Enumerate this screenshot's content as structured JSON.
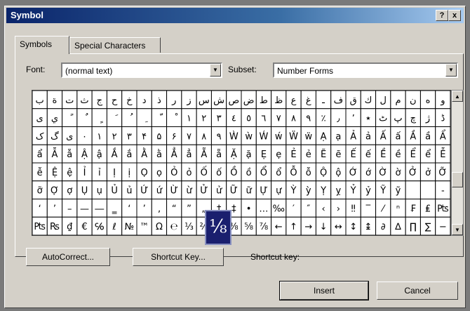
{
  "window": {
    "title": "Symbol",
    "help_label": "?",
    "close_label": "x"
  },
  "tabs": [
    {
      "label": "Symbols"
    },
    {
      "label": "Special Characters"
    }
  ],
  "font": {
    "label": "Font:",
    "value": "(normal text)"
  },
  "subset": {
    "label": "Subset:",
    "value": "Number Forms"
  },
  "popup": {
    "value": "⅛"
  },
  "buttons": {
    "autocorrect": "AutoCorrect...",
    "shortcut_key": "Shortcut Key...",
    "shortcut_label": "Shortcut key:",
    "insert": "Insert",
    "cancel": "Cancel"
  },
  "grid": {
    "rows": [
      [
        "ب",
        "ة",
        "ت",
        "ث",
        "ج",
        "ح",
        "خ",
        "د",
        "ذ",
        "ر",
        "ز",
        "س",
        "ش",
        "ص",
        "ض",
        "ط",
        "ظ",
        "ع",
        "غ",
        "ـ",
        "ف",
        "ق",
        "ك",
        "ل",
        "م",
        "ن",
        "ه",
        "و"
      ],
      [
        "ى",
        "ي",
        "ً",
        "ٌ",
        "ٍ",
        "َ",
        "ُ",
        "ِ",
        "ّ",
        "ْ",
        "١",
        "٢",
        "٣",
        "٤",
        "٥",
        "٦",
        "٧",
        "٨",
        "٩",
        "٪",
        "٫",
        "٬",
        "٭",
        "ٹ",
        "پ",
        "چ",
        "ژ",
        "ڈ"
      ],
      [
        "ک",
        "گ",
        "ی",
        "۰",
        "۱",
        "۲",
        "۳",
        "۴",
        "۵",
        "۶",
        "۷",
        "۸",
        "۹",
        "Ẁ",
        "ẁ",
        "Ẃ",
        "ẃ",
        "Ẅ",
        "ẅ",
        "Ạ",
        "ạ",
        "Ả",
        "ả",
        "Ấ",
        "ấ",
        "Ầ",
        "ầ",
        "Ẩ"
      ],
      [
        "ẩ",
        "Ẫ",
        "ẫ",
        "Ậ",
        "ậ",
        "Ắ",
        "ắ",
        "Ằ",
        "ằ",
        "Ẳ",
        "ẳ",
        "Ẵ",
        "ẵ",
        "Ặ",
        "ặ",
        "Ẹ",
        "ẹ",
        "Ẻ",
        "ẻ",
        "Ẽ",
        "ẽ",
        "Ế",
        "ế",
        "Ề",
        "ề",
        "Ể",
        "ể",
        "Ễ"
      ],
      [
        "ễ",
        "Ệ",
        "ệ",
        "Ỉ",
        "ỉ",
        "Ị",
        "ị",
        "Ọ",
        "ọ",
        "Ỏ",
        "ỏ",
        "Ố",
        "ố",
        "Ồ",
        "ồ",
        "Ổ",
        "ổ",
        "Ỗ",
        "ỗ",
        "Ộ",
        "ộ",
        "Ớ",
        "ớ",
        "Ờ",
        "ờ",
        "Ở",
        "ở",
        "Ỡ"
      ],
      [
        "ỡ",
        "Ợ",
        "ợ",
        "Ụ",
        "ụ",
        "Ủ",
        "ủ",
        "Ứ",
        "ứ",
        "Ừ",
        "ừ",
        "Ử",
        "ử",
        "Ữ",
        "ữ",
        "Ự",
        "ự",
        "Ỳ",
        "ỳ",
        "Ỵ",
        "ỵ",
        "Ỷ",
        "ỷ",
        "Ỹ",
        "ỹ",
        "‌",
        "‍",
        "‐"
      ],
      [
        "‘",
        "’",
        "–",
        "—",
        "―",
        "‗",
        "‘",
        "’",
        "‚",
        "“",
        "”",
        "„",
        "†",
        "‡",
        "•",
        "…",
        "‰",
        "′",
        "″",
        "‹",
        "›",
        "‼",
        "‾",
        "⁄",
        "ⁿ",
        "₣",
        "₤",
        "₧"
      ],
      [
        "₧",
        "₨",
        "₫",
        "€",
        "℅",
        "ℓ",
        "№",
        "™",
        "Ω",
        "℮",
        "⅓",
        "⅔",
        "⅛",
        "⅜",
        "⅝",
        "⅞",
        "←",
        "↑",
        "→",
        "↓",
        "↔",
        "↕",
        "↨",
        "∂",
        "∆",
        "∏",
        "∑",
        "−"
      ]
    ]
  }
}
